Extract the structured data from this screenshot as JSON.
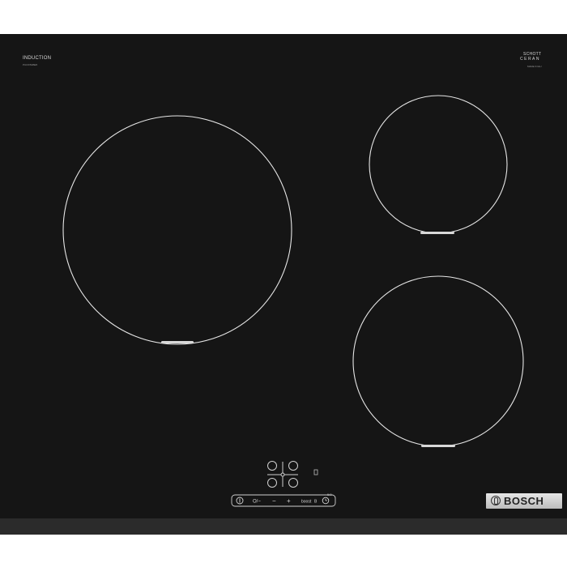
{
  "hob": {
    "type_label": "INDUCTION",
    "model_label": "PUC6/5ABE5",
    "ceran_line1": "SCHOTT",
    "ceran_line2": "CERAN",
    "ceran_sub": "MADE IN EU",
    "brand": "BOSCH",
    "zones": [
      "large-left",
      "small-top-right",
      "medium-bottom-right"
    ]
  },
  "controls": {
    "labels": [
      "i/O",
      "Off",
      "−",
      "+",
      "boost",
      "timer"
    ],
    "power_symbol": "I",
    "off_text": "O/−",
    "minus": "−",
    "plus": "+",
    "boost_text": "boost",
    "boost_mark": "B",
    "indicator_text": "5/8",
    "timer_label": "min"
  },
  "colors": {
    "glass": "#151515",
    "ring": "#e6e6e6",
    "badge": "#cfcfcf"
  }
}
